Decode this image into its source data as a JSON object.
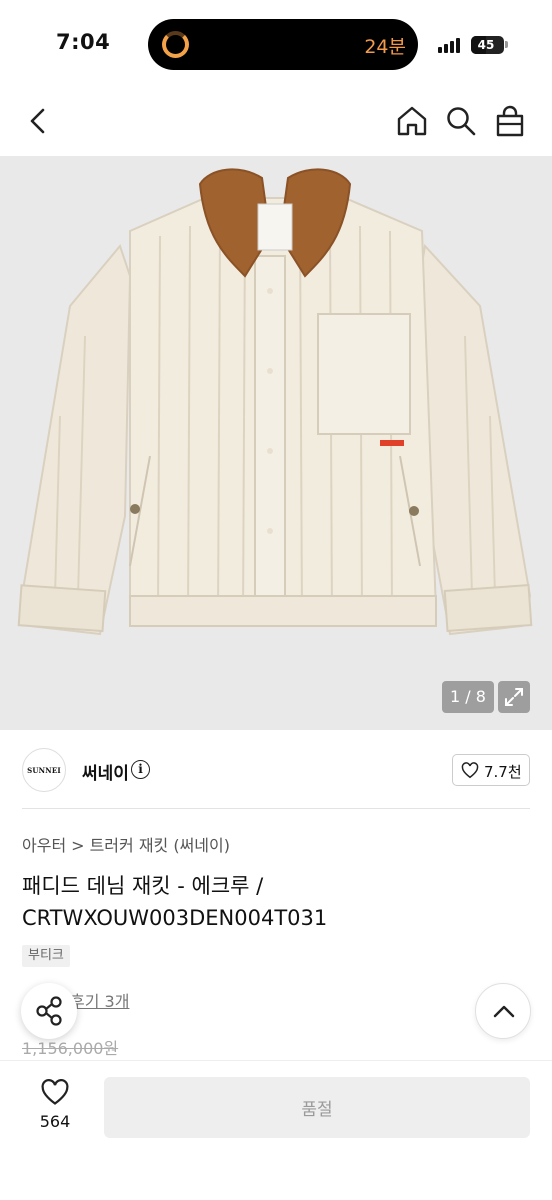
{
  "status_bar": {
    "time": "7:04",
    "activity_text": "24분",
    "battery_level": "45"
  },
  "nav": {
    "icons": [
      "back-icon",
      "home-icon",
      "search-icon",
      "shopping-bag-icon"
    ]
  },
  "gallery": {
    "pager": "1 / 8"
  },
  "brand": {
    "logo_text": "SUNNEI",
    "name": "써네이",
    "info": "i",
    "likes": "7.7천"
  },
  "breadcrumb": {
    "category": "아우터",
    "separator": ">",
    "subcategory": "트러커 재킷 (써네이)"
  },
  "product": {
    "title": "패디드 데님 재킷 - 에크루 / CRTWXOUW003DEN004T031",
    "badge": "부티크",
    "review_link": "후기 3개",
    "original_price": "1,156,000원"
  },
  "bottom_bar": {
    "heart_count": "564",
    "sold_out_label": "품절"
  },
  "colors": {
    "jacket": "#f1ebde",
    "collar": "#a0622e",
    "background": "#e9e9e9",
    "activity": "#f39a4a"
  }
}
